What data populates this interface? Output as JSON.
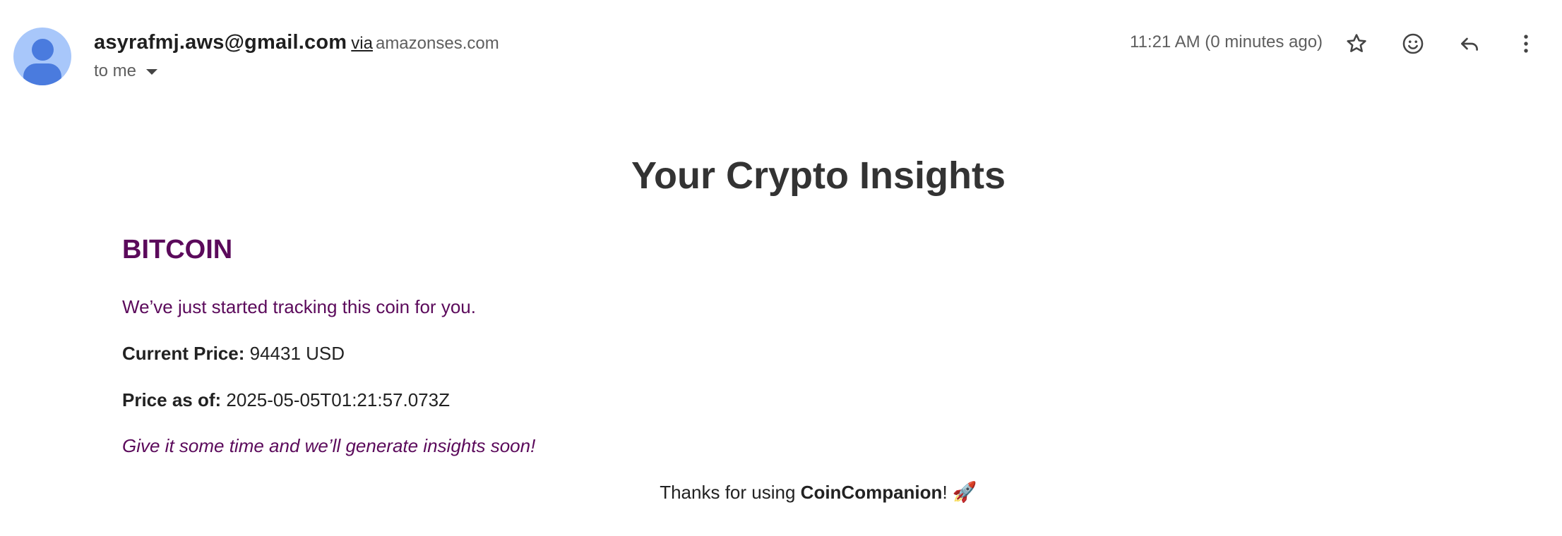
{
  "header": {
    "sender_email": "asyrafmj.aws@gmail.com",
    "via_label": "via",
    "via_domain": "amazonses.com",
    "recipient_label": "to me",
    "timestamp": "11:21 AM (0 minutes ago)",
    "icons": [
      "avatar",
      "star-icon",
      "emoji-icon",
      "reply-icon",
      "more-vert-icon",
      "chevron-down-icon"
    ]
  },
  "email": {
    "heading": "Your Crypto Insights",
    "coin_name": "BITCOIN",
    "status_text": "We’ve just started tracking this coin for you.",
    "price_label": "Current Price:",
    "price_value": "94431 USD",
    "asof_label": "Price as of:",
    "asof_value": "2025-05-05T01:21:57.073Z",
    "note": "Give it some time and we’ll generate insights soon!",
    "thanks_prefix": "Thanks for using",
    "brand": "CoinCompanion",
    "thanks_suffix": "!",
    "rocket": "🚀"
  },
  "colors": {
    "coin_accent": "#5b0a5b",
    "heading": "#333333",
    "avatar_bg": "#a8c7fa",
    "avatar_fg": "#4a7bde",
    "muted_text": "#5e5e5e"
  }
}
